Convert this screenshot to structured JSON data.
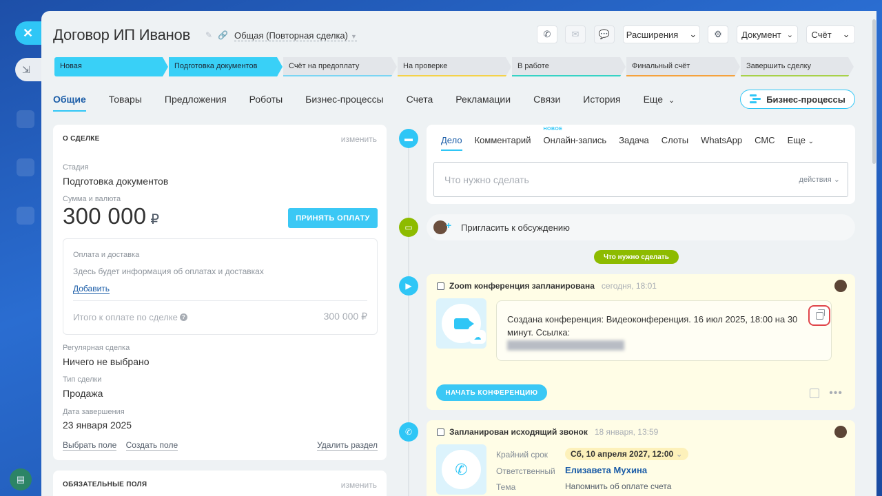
{
  "deal": {
    "title": "Договор ИП Иванов",
    "category": "Общая (Повторная сделка)"
  },
  "toolbar": {
    "extensions": "Расширения",
    "document": "Документ",
    "invoice": "Счёт"
  },
  "stages": [
    {
      "label": "Новая",
      "state": "active",
      "color": "#39d0f7"
    },
    {
      "label": "Подготовка документов",
      "state": "active",
      "color": "#39d0f7"
    },
    {
      "label": "Счёт на предоплату",
      "state": "inactive",
      "color": "#7bd5f3"
    },
    {
      "label": "На проверке",
      "state": "inactive",
      "color": "#f4d24a"
    },
    {
      "label": "В работе",
      "state": "inactive",
      "color": "#37d3c5"
    },
    {
      "label": "Финальный счёт",
      "state": "inactive",
      "color": "#f5a23d"
    },
    {
      "label": "Завершить сделку",
      "state": "inactive",
      "color": "#a8d14a"
    }
  ],
  "tabs": [
    {
      "label": "Общие",
      "active": true
    },
    {
      "label": "Товары",
      "active": false
    },
    {
      "label": "Предложения",
      "active": false
    },
    {
      "label": "Роботы",
      "active": false
    },
    {
      "label": "Бизнес-процессы",
      "active": false
    },
    {
      "label": "Счета",
      "active": false
    },
    {
      "label": "Рекламации",
      "active": false
    },
    {
      "label": "Связи",
      "active": false
    },
    {
      "label": "История",
      "active": false
    },
    {
      "label": "Еще",
      "active": false
    }
  ],
  "bp_button": "Бизнес-процессы",
  "about": {
    "header": "О СДЕЛКЕ",
    "edit": "изменить",
    "stage_label": "Стадия",
    "stage_value": "Подготовка документов",
    "amount_label": "Сумма и валюта",
    "amount_value": "300 000",
    "currency": "₽",
    "accept_payment": "ПРИНЯТЬ ОПЛАТУ",
    "payment_box": {
      "title": "Оплата и доставка",
      "info": "Здесь будет информация об оплатах и доставках",
      "add": "Добавить",
      "total_label": "Итого к оплате по сделке",
      "total_value": "300 000 ₽"
    },
    "regular_label": "Регулярная сделка",
    "regular_value": "Ничего не выбрано",
    "type_label": "Тип сделки",
    "type_value": "Продажа",
    "close_label": "Дата завершения",
    "close_value": "23 января 2025",
    "select_field": "Выбрать поле",
    "create_field": "Создать поле",
    "delete_section": "Удалить раздел"
  },
  "required": {
    "header": "ОБЯЗАТЕЛЬНЫЕ ПОЛЯ",
    "edit": "изменить"
  },
  "editor": {
    "tabs": [
      "Дело",
      "Комментарий",
      "Онлайн-запись",
      "Задача",
      "Слоты",
      "WhatsApp",
      "СМС",
      "Еще"
    ],
    "new_badge": "НОВОЕ",
    "placeholder": "Что нужно сделать",
    "actions": "действия"
  },
  "invite": "Пригласить к обсуждению",
  "todo_pill": "Что нужно сделать",
  "zoom_activity": {
    "title": "Zoom конференция запланирована",
    "time": "сегодня, 18:01",
    "text": "Создана конференция: Видеоконференция. 16 июл 2025, 18:00 на 30 минут. Ссылка:",
    "start": "НАЧАТЬ КОНФЕРЕНЦИЮ"
  },
  "call_activity": {
    "title": "Запланирован исходящий звонок",
    "time": "18 января, 13:59",
    "deadline_label": "Крайний срок",
    "deadline_value": "Сб, 10 апреля 2027, 12:00",
    "responsible_label": "Ответственный",
    "responsible_value": "Елизавета Мухина",
    "topic_label": "Тема",
    "topic_value": "Напомнить об оплате счета"
  }
}
